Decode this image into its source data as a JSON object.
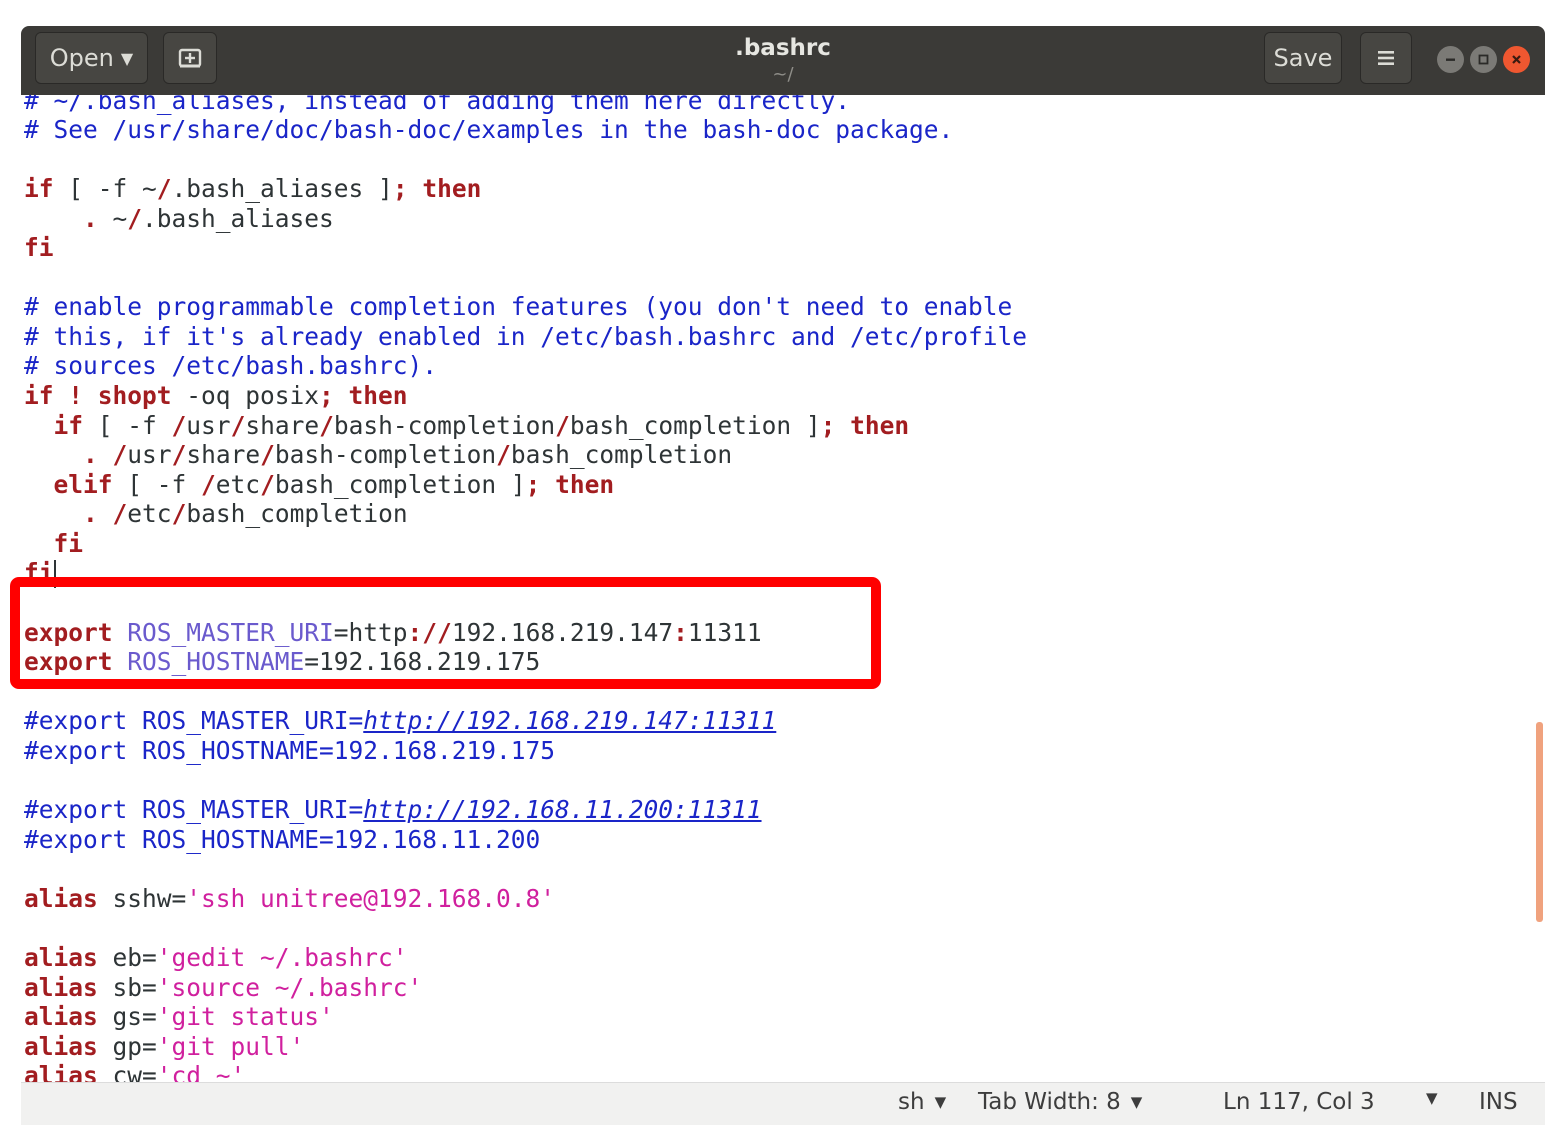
{
  "header": {
    "open_label": "Open",
    "title": ".bashrc",
    "subtitle": "~/",
    "save_label": "Save"
  },
  "icons": {
    "open_dropdown": "chevron-down-icon",
    "new_tab": "new-document-icon",
    "menu": "hamburger-menu-icon",
    "minimize": "window-minimize-icon",
    "maximize": "window-maximize-icon",
    "close": "window-close-icon"
  },
  "editor": {
    "lines": {
      "l0": "# ~/.bash_aliases, instead of adding them here directly.",
      "l1": "# See /usr/share/doc/bash-doc/examples in the bash-doc package.",
      "l3a": "if",
      "l3b": " [ -f ~",
      "l3c": "/",
      "l3d": ".bash_aliases ]",
      "l3e": ";",
      "l3f": " then",
      "l4a": "    .",
      "l4b": " ~",
      "l4c": "/",
      "l4d": ".bash_aliases",
      "l5": "fi",
      "l7": "# enable programmable completion features (you don't need to enable",
      "l8": "# this, if it's already enabled in /etc/bash.bashrc and /etc/profile",
      "l9": "# sources /etc/bash.bashrc).",
      "l10a": "if ! shopt",
      "l10b": " -oq posix",
      "l10c": ";",
      "l10d": " then",
      "l11a": "  if",
      "l11b": " [ -f ",
      "l11c": "/",
      "l11d": "usr",
      "l11e": "/",
      "l11f": "share",
      "l11g": "/",
      "l11h": "bash-completion",
      "l11i": "/",
      "l11j": "bash_completion ]",
      "l11k": ";",
      "l11l": " then",
      "l12a": "    .",
      "l12b": " ",
      "l12c": "/",
      "l12d": "usr",
      "l12e": "/",
      "l12f": "share",
      "l12g": "/",
      "l12h": "bash-completion",
      "l12i": "/",
      "l12j": "bash_completion",
      "l13a": "  elif",
      "l13b": " [ -f ",
      "l13c": "/",
      "l13d": "etc",
      "l13e": "/",
      "l13f": "bash_completion ]",
      "l13g": ";",
      "l13h": " then",
      "l14a": "    .",
      "l14b": " ",
      "l14c": "/",
      "l14d": "etc",
      "l14e": "/",
      "l14f": "bash_completion",
      "l15": "  fi",
      "l16": "fi",
      "l18a": "export",
      "l18b": " ROS_MASTER_URI",
      "l18c": "=http",
      "l18d": "://",
      "l18e": "192.168.219.147",
      "l18f": ":",
      "l18g": "11311",
      "l19a": "export",
      "l19b": " ROS_HOSTNAME",
      "l19c": "=192.168.219.175",
      "l20a": "#export ROS_MASTER_URI=",
      "l20b": "http://192.168.219.147:11311",
      "l21": "#export ROS_HOSTNAME=192.168.219.175",
      "l23a": "#export ROS_MASTER_URI=",
      "l23b": "http://192.168.11.200:11311",
      "l24": "#export ROS_HOSTNAME=192.168.11.200",
      "l26a": "alias",
      "l26b": " sshw=",
      "l26c": "'ssh unitree@192.168.0.8'",
      "l28a": "alias",
      "l28b": " eb=",
      "l28c": "'gedit ~/.bashrc'",
      "l29a": "alias",
      "l29b": " sb=",
      "l29c": "'source ~/.bashrc'",
      "l30a": "alias",
      "l30b": " gs=",
      "l30c": "'git status'",
      "l31a": "alias",
      "l31b": " gp=",
      "l31c": "'git pull'",
      "l32a": "alias",
      "l32b": " cw=",
      "l32c": "'cd ~'"
    }
  },
  "statusbar": {
    "language": "sh",
    "tab_width": "Tab Width: 8",
    "position": "Ln 117, Col 3",
    "mode": "INS"
  }
}
